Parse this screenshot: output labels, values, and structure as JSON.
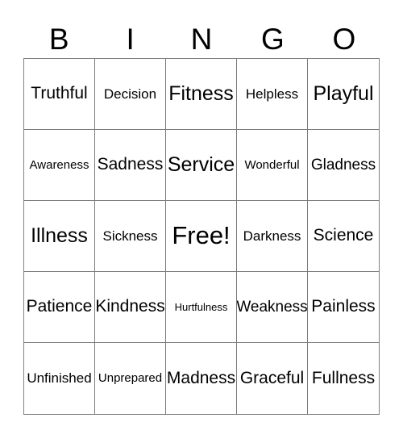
{
  "card": {
    "header_letters": [
      "B",
      "I",
      "N",
      "G",
      "O"
    ],
    "free_space_label": "Free!",
    "border_color": "#7a7a7a",
    "background_color": "#ffffff",
    "text_color": "#000000",
    "rows": [
      [
        {
          "label": "Truthful",
          "size": "fs-xl"
        },
        {
          "label": "Decision",
          "size": "fs-m"
        },
        {
          "label": "Fitness",
          "size": "fs-xxl"
        },
        {
          "label": "Helpless",
          "size": "fs-m"
        },
        {
          "label": "Playful",
          "size": "fs-xxl"
        }
      ],
      [
        {
          "label": "Awareness",
          "size": "fs-s"
        },
        {
          "label": "Sadness",
          "size": "fs-xl"
        },
        {
          "label": "Service",
          "size": "fs-xxl"
        },
        {
          "label": "Wonderful",
          "size": "fs-s"
        },
        {
          "label": "Gladness",
          "size": "fs-l"
        }
      ],
      [
        {
          "label": "Illness",
          "size": "fs-xxl"
        },
        {
          "label": "Sickness",
          "size": "fs-m"
        },
        {
          "label": "Free!",
          "size": "fs-free"
        },
        {
          "label": "Darkness",
          "size": "fs-m"
        },
        {
          "label": "Science",
          "size": "fs-xl"
        }
      ],
      [
        {
          "label": "Patience",
          "size": "fs-xl"
        },
        {
          "label": "Kindness",
          "size": "fs-xl"
        },
        {
          "label": "Hurtfulness",
          "size": "fs-xs"
        },
        {
          "label": "Weakness",
          "size": "fs-l"
        },
        {
          "label": "Painless",
          "size": "fs-xl"
        }
      ],
      [
        {
          "label": "Unfinished",
          "size": "fs-m"
        },
        {
          "label": "Unprepared",
          "size": "fs-s"
        },
        {
          "label": "Madness",
          "size": "fs-xl"
        },
        {
          "label": "Graceful",
          "size": "fs-xl"
        },
        {
          "label": "Fullness",
          "size": "fs-xl"
        }
      ]
    ]
  }
}
